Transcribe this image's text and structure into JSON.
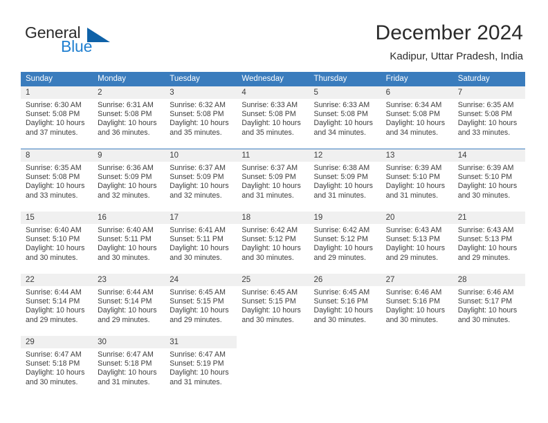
{
  "brand": {
    "name_top": "General",
    "name_bottom": "Blue",
    "triangle_color": "#0f62a8",
    "blue_color": "#1f7fd0"
  },
  "header": {
    "title": "December 2024",
    "subtitle": "Kadipur, Uttar Pradesh, India"
  },
  "theme": {
    "header_row_bg": "#3a7cbd",
    "date_band_bg": "#f0f0f0",
    "text": "#3c3c3c"
  },
  "weekday_headers": [
    "Sunday",
    "Monday",
    "Tuesday",
    "Wednesday",
    "Thursday",
    "Friday",
    "Saturday"
  ],
  "labels": {
    "sunrise_prefix": "Sunrise:",
    "sunset_prefix": "Sunset:",
    "daylight_prefix": "Daylight:"
  },
  "weeks": [
    [
      {
        "day": "1",
        "sunrise": "Sunrise: 6:30 AM",
        "sunset": "Sunset: 5:08 PM",
        "daylight_line1": "Daylight: 10 hours",
        "daylight_line2": "and 37 minutes."
      },
      {
        "day": "2",
        "sunrise": "Sunrise: 6:31 AM",
        "sunset": "Sunset: 5:08 PM",
        "daylight_line1": "Daylight: 10 hours",
        "daylight_line2": "and 36 minutes."
      },
      {
        "day": "3",
        "sunrise": "Sunrise: 6:32 AM",
        "sunset": "Sunset: 5:08 PM",
        "daylight_line1": "Daylight: 10 hours",
        "daylight_line2": "and 35 minutes."
      },
      {
        "day": "4",
        "sunrise": "Sunrise: 6:33 AM",
        "sunset": "Sunset: 5:08 PM",
        "daylight_line1": "Daylight: 10 hours",
        "daylight_line2": "and 35 minutes."
      },
      {
        "day": "5",
        "sunrise": "Sunrise: 6:33 AM",
        "sunset": "Sunset: 5:08 PM",
        "daylight_line1": "Daylight: 10 hours",
        "daylight_line2": "and 34 minutes."
      },
      {
        "day": "6",
        "sunrise": "Sunrise: 6:34 AM",
        "sunset": "Sunset: 5:08 PM",
        "daylight_line1": "Daylight: 10 hours",
        "daylight_line2": "and 34 minutes."
      },
      {
        "day": "7",
        "sunrise": "Sunrise: 6:35 AM",
        "sunset": "Sunset: 5:08 PM",
        "daylight_line1": "Daylight: 10 hours",
        "daylight_line2": "and 33 minutes."
      }
    ],
    [
      {
        "day": "8",
        "sunrise": "Sunrise: 6:35 AM",
        "sunset": "Sunset: 5:08 PM",
        "daylight_line1": "Daylight: 10 hours",
        "daylight_line2": "and 33 minutes."
      },
      {
        "day": "9",
        "sunrise": "Sunrise: 6:36 AM",
        "sunset": "Sunset: 5:09 PM",
        "daylight_line1": "Daylight: 10 hours",
        "daylight_line2": "and 32 minutes."
      },
      {
        "day": "10",
        "sunrise": "Sunrise: 6:37 AM",
        "sunset": "Sunset: 5:09 PM",
        "daylight_line1": "Daylight: 10 hours",
        "daylight_line2": "and 32 minutes."
      },
      {
        "day": "11",
        "sunrise": "Sunrise: 6:37 AM",
        "sunset": "Sunset: 5:09 PM",
        "daylight_line1": "Daylight: 10 hours",
        "daylight_line2": "and 31 minutes."
      },
      {
        "day": "12",
        "sunrise": "Sunrise: 6:38 AM",
        "sunset": "Sunset: 5:09 PM",
        "daylight_line1": "Daylight: 10 hours",
        "daylight_line2": "and 31 minutes."
      },
      {
        "day": "13",
        "sunrise": "Sunrise: 6:39 AM",
        "sunset": "Sunset: 5:10 PM",
        "daylight_line1": "Daylight: 10 hours",
        "daylight_line2": "and 31 minutes."
      },
      {
        "day": "14",
        "sunrise": "Sunrise: 6:39 AM",
        "sunset": "Sunset: 5:10 PM",
        "daylight_line1": "Daylight: 10 hours",
        "daylight_line2": "and 30 minutes."
      }
    ],
    [
      {
        "day": "15",
        "sunrise": "Sunrise: 6:40 AM",
        "sunset": "Sunset: 5:10 PM",
        "daylight_line1": "Daylight: 10 hours",
        "daylight_line2": "and 30 minutes."
      },
      {
        "day": "16",
        "sunrise": "Sunrise: 6:40 AM",
        "sunset": "Sunset: 5:11 PM",
        "daylight_line1": "Daylight: 10 hours",
        "daylight_line2": "and 30 minutes."
      },
      {
        "day": "17",
        "sunrise": "Sunrise: 6:41 AM",
        "sunset": "Sunset: 5:11 PM",
        "daylight_line1": "Daylight: 10 hours",
        "daylight_line2": "and 30 minutes."
      },
      {
        "day": "18",
        "sunrise": "Sunrise: 6:42 AM",
        "sunset": "Sunset: 5:12 PM",
        "daylight_line1": "Daylight: 10 hours",
        "daylight_line2": "and 30 minutes."
      },
      {
        "day": "19",
        "sunrise": "Sunrise: 6:42 AM",
        "sunset": "Sunset: 5:12 PM",
        "daylight_line1": "Daylight: 10 hours",
        "daylight_line2": "and 29 minutes."
      },
      {
        "day": "20",
        "sunrise": "Sunrise: 6:43 AM",
        "sunset": "Sunset: 5:13 PM",
        "daylight_line1": "Daylight: 10 hours",
        "daylight_line2": "and 29 minutes."
      },
      {
        "day": "21",
        "sunrise": "Sunrise: 6:43 AM",
        "sunset": "Sunset: 5:13 PM",
        "daylight_line1": "Daylight: 10 hours",
        "daylight_line2": "and 29 minutes."
      }
    ],
    [
      {
        "day": "22",
        "sunrise": "Sunrise: 6:44 AM",
        "sunset": "Sunset: 5:14 PM",
        "daylight_line1": "Daylight: 10 hours",
        "daylight_line2": "and 29 minutes."
      },
      {
        "day": "23",
        "sunrise": "Sunrise: 6:44 AM",
        "sunset": "Sunset: 5:14 PM",
        "daylight_line1": "Daylight: 10 hours",
        "daylight_line2": "and 29 minutes."
      },
      {
        "day": "24",
        "sunrise": "Sunrise: 6:45 AM",
        "sunset": "Sunset: 5:15 PM",
        "daylight_line1": "Daylight: 10 hours",
        "daylight_line2": "and 29 minutes."
      },
      {
        "day": "25",
        "sunrise": "Sunrise: 6:45 AM",
        "sunset": "Sunset: 5:15 PM",
        "daylight_line1": "Daylight: 10 hours",
        "daylight_line2": "and 30 minutes."
      },
      {
        "day": "26",
        "sunrise": "Sunrise: 6:45 AM",
        "sunset": "Sunset: 5:16 PM",
        "daylight_line1": "Daylight: 10 hours",
        "daylight_line2": "and 30 minutes."
      },
      {
        "day": "27",
        "sunrise": "Sunrise: 6:46 AM",
        "sunset": "Sunset: 5:16 PM",
        "daylight_line1": "Daylight: 10 hours",
        "daylight_line2": "and 30 minutes."
      },
      {
        "day": "28",
        "sunrise": "Sunrise: 6:46 AM",
        "sunset": "Sunset: 5:17 PM",
        "daylight_line1": "Daylight: 10 hours",
        "daylight_line2": "and 30 minutes."
      }
    ],
    [
      {
        "day": "29",
        "sunrise": "Sunrise: 6:47 AM",
        "sunset": "Sunset: 5:18 PM",
        "daylight_line1": "Daylight: 10 hours",
        "daylight_line2": "and 30 minutes."
      },
      {
        "day": "30",
        "sunrise": "Sunrise: 6:47 AM",
        "sunset": "Sunset: 5:18 PM",
        "daylight_line1": "Daylight: 10 hours",
        "daylight_line2": "and 31 minutes."
      },
      {
        "day": "31",
        "sunrise": "Sunrise: 6:47 AM",
        "sunset": "Sunset: 5:19 PM",
        "daylight_line1": "Daylight: 10 hours",
        "daylight_line2": "and 31 minutes."
      },
      {
        "day": "",
        "sunrise": "",
        "sunset": "",
        "daylight_line1": "",
        "daylight_line2": ""
      },
      {
        "day": "",
        "sunrise": "",
        "sunset": "",
        "daylight_line1": "",
        "daylight_line2": ""
      },
      {
        "day": "",
        "sunrise": "",
        "sunset": "",
        "daylight_line1": "",
        "daylight_line2": ""
      },
      {
        "day": "",
        "sunrise": "",
        "sunset": "",
        "daylight_line1": "",
        "daylight_line2": ""
      }
    ]
  ]
}
